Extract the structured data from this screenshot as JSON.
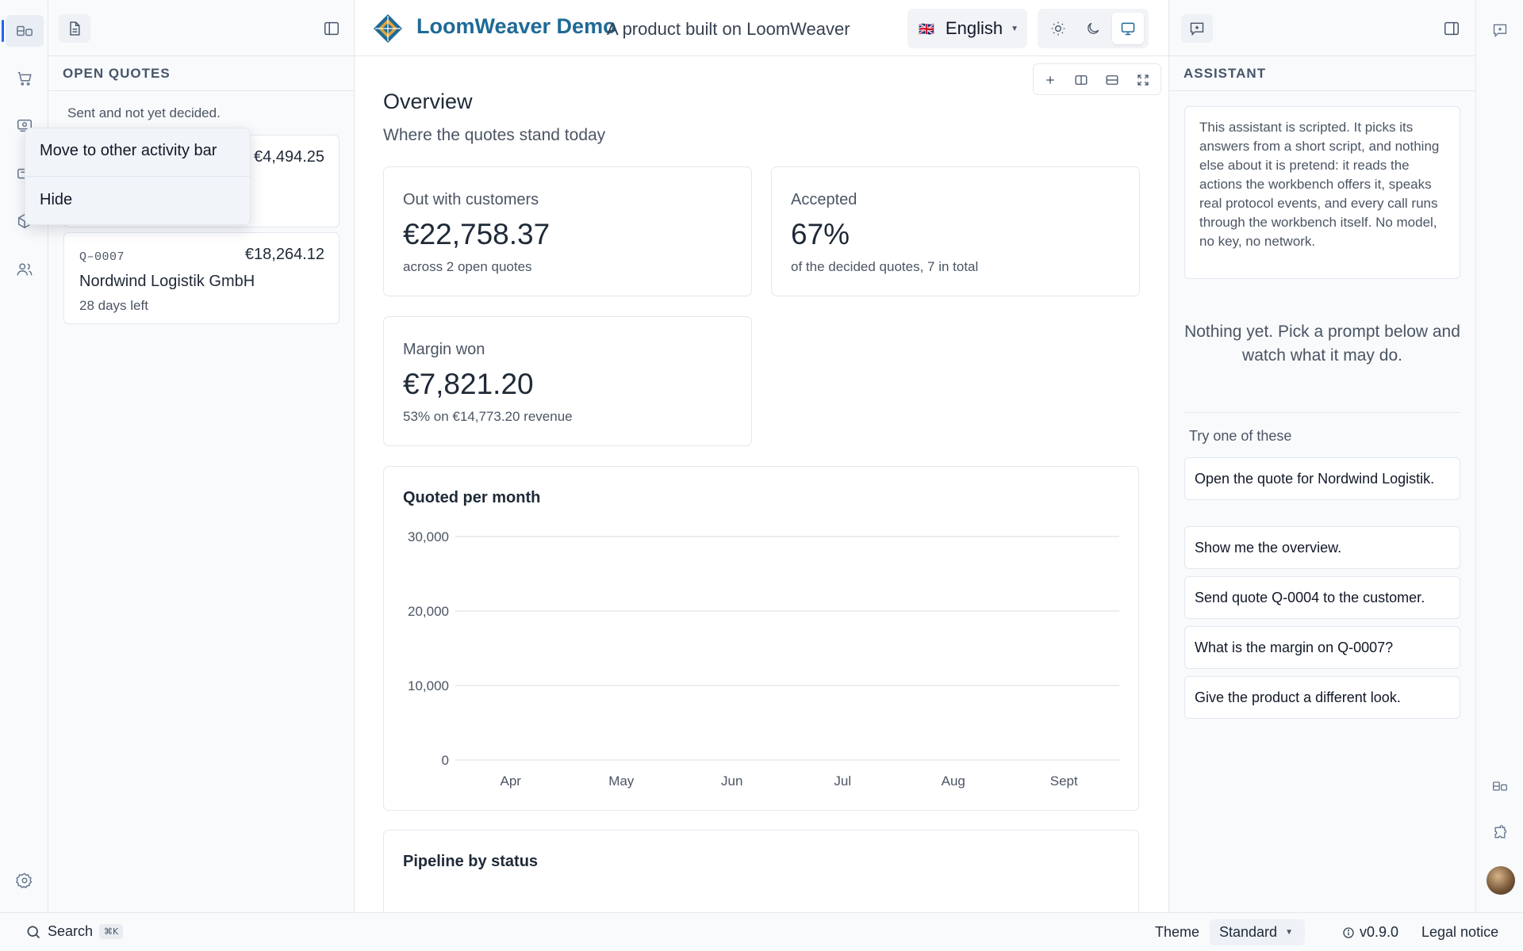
{
  "header": {
    "brand": "LoomWeaver Demo",
    "tagline": "A product built on LoomWeaver",
    "language": {
      "flag": "🇬🇧",
      "label": "English"
    },
    "theme_modes": [
      "light",
      "dark",
      "system"
    ],
    "active_theme_mode": "system",
    "brand_color": "#1e6a96"
  },
  "left_panel": {
    "section_title": "OPEN QUOTES",
    "subtitle": "Sent and not yet decided.",
    "quotes": [
      {
        "number": "",
        "amount": "€4,494.25",
        "name": "",
        "days_left": ""
      },
      {
        "number": "Q–0007",
        "amount": "€18,264.12",
        "name": "Nordwind Logistik GmbH",
        "days_left": "28 days left"
      }
    ]
  },
  "context_menu": {
    "items": [
      "Move to other activity bar",
      "Hide"
    ]
  },
  "main": {
    "title": "Overview",
    "subtitle": "Where the quotes stand today",
    "stats": [
      {
        "label": "Out with customers",
        "value": "€22,758.37",
        "note": "across 2 open quotes"
      },
      {
        "label": "Accepted",
        "value": "67%",
        "note": "of the decided quotes, 7 in total"
      },
      {
        "label": "Margin won",
        "value": "€7,821.20",
        "note": "53% on €14,773.20 revenue"
      }
    ],
    "pipeline_title": "Pipeline by status"
  },
  "chart_data": {
    "type": "bar",
    "title": "Quoted per month",
    "categories": [
      "Apr",
      "May",
      "Jun",
      "Jul",
      "Aug",
      "Sept"
    ],
    "values": [
      0,
      0,
      0,
      0,
      0,
      0
    ],
    "yticks": [
      "0",
      "10,000",
      "20,000",
      "30,000"
    ],
    "ylim": [
      0,
      30000
    ],
    "grid": true,
    "xlabel": "",
    "ylabel": ""
  },
  "assistant": {
    "section_title": "ASSISTANT",
    "note": "This assistant is scripted. It picks its answers from a short script, and nothing else about it is pretend: it reads the actions the workbench offers it, speaks real protocol events, and every call runs through the workbench itself. No model, no key, no network.",
    "empty_message": "Nothing yet. Pick a prompt below and watch what it may do.",
    "try_label": "Try one of these",
    "prompts": [
      "Open the quote for Nordwind Logistik.",
      "Show me the overview.",
      "Send quote Q-0004 to the customer.",
      "What is the margin on Q-0007?",
      "Give the product a different look."
    ]
  },
  "statusbar": {
    "search_label": "Search",
    "search_shortcut": "⌘K",
    "theme_label": "Theme",
    "theme_value": "Standard",
    "version": "v0.9.0",
    "legal": "Legal notice"
  }
}
